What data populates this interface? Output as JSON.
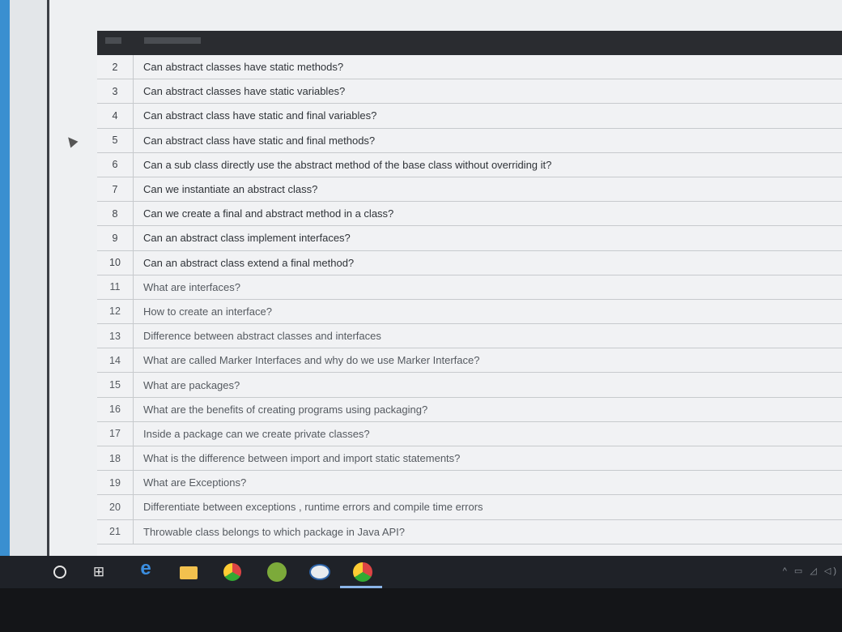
{
  "table": {
    "rows": [
      {
        "no": "2",
        "question": "Can abstract classes have static methods?"
      },
      {
        "no": "3",
        "question": "Can abstract classes have static variables?"
      },
      {
        "no": "4",
        "question": "Can abstract class have static and final variables?"
      },
      {
        "no": "5",
        "question": "Can abstract class have static and final methods?"
      },
      {
        "no": "6",
        "question": "Can a sub class directly use the abstract method of the base class without overriding it?"
      },
      {
        "no": "7",
        "question": "Can we instantiate an abstract class?"
      },
      {
        "no": "8",
        "question": "Can we create a final and abstract method in a class?"
      },
      {
        "no": "9",
        "question": "Can an abstract class implement interfaces?"
      },
      {
        "no": "10",
        "question": "Can an abstract class extend a final method?"
      },
      {
        "no": "11",
        "question": "What are interfaces?"
      },
      {
        "no": "12",
        "question": "How to create an interface?"
      },
      {
        "no": "13",
        "question": "Difference between abstract classes and interfaces"
      },
      {
        "no": "14",
        "question": "What are called Marker Interfaces and why do we use Marker Interface?"
      },
      {
        "no": "15",
        "question": "What are packages?"
      },
      {
        "no": "16",
        "question": "What are the benefits of creating programs using packaging?"
      },
      {
        "no": "17",
        "question": "Inside a package can we create private classes?"
      },
      {
        "no": "18",
        "question": "What is the difference between import and import static statements?"
      },
      {
        "no": "19",
        "question": "What are Exceptions?"
      },
      {
        "no": "20",
        "question": "Differentiate between exceptions , runtime errors and compile time errors"
      },
      {
        "no": "21",
        "question": "Throwable class belongs to which package in Java API?"
      }
    ]
  },
  "taskbar": {
    "icons": [
      "cortana-icon",
      "task-view-icon",
      "edge-icon",
      "file-explorer-icon",
      "chrome-icon",
      "green-app-icon",
      "ide-app-icon",
      "chrome-profile-icon"
    ],
    "tray": "^ ▭ ◿ ◁)"
  },
  "colors": {
    "header": "#2a2c30",
    "taskbar": "#1f2228",
    "accent": "#3a8fd0"
  }
}
